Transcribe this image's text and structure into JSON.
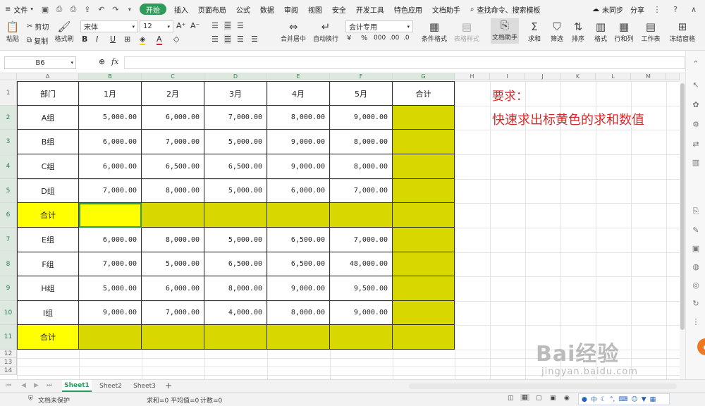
{
  "menubar": {
    "file_label": "文件",
    "tabs": [
      "开始",
      "插入",
      "页面布局",
      "公式",
      "数据",
      "审阅",
      "视图",
      "安全",
      "开发工具",
      "特色应用",
      "文档助手"
    ],
    "search_label": "查找命令、搜索模板",
    "sync_label": "未同步",
    "share_label": "分享"
  },
  "ribbon": {
    "paste": "粘贴",
    "cut": "剪切",
    "copy": "复制",
    "format_painter": "格式刷",
    "font_name": "宋体",
    "font_size": "12",
    "merge_center": "合并居中",
    "wrap_text": "自动换行",
    "number_format": "会计专用",
    "cond_format": "条件格式",
    "table_style": "表格样式",
    "doc_helper": "文档助手",
    "sum": "求和",
    "filter": "筛选",
    "sort": "排序",
    "format": "格式",
    "row_col": "行和列",
    "worksheet": "工作表",
    "freeze": "冻结窗格"
  },
  "formula_bar": {
    "name_box": "B6",
    "fx_label": "fx",
    "content": ""
  },
  "columns": [
    "A",
    "B",
    "C",
    "D",
    "E",
    "F",
    "G",
    "H",
    "I",
    "J",
    "K",
    "L",
    "M"
  ],
  "rows": [
    "1",
    "2",
    "3",
    "4",
    "5",
    "6",
    "7",
    "8",
    "9",
    "10",
    "11",
    "12",
    "13",
    "14"
  ],
  "table": {
    "headers": [
      "部门",
      "1月",
      "2月",
      "3月",
      "4月",
      "5月",
      "合计"
    ],
    "data": [
      [
        "A组",
        "5,000.00",
        "6,000.00",
        "7,000.00",
        "8,000.00",
        "9,000.00",
        ""
      ],
      [
        "B组",
        "6,000.00",
        "7,000.00",
        "5,000.00",
        "9,000.00",
        "8,000.00",
        ""
      ],
      [
        "C组",
        "6,000.00",
        "6,500.00",
        "6,500.00",
        "9,000.00",
        "8,000.00",
        ""
      ],
      [
        "D组",
        "7,000.00",
        "8,000.00",
        "5,000.00",
        "6,000.00",
        "7,000.00",
        ""
      ],
      [
        "合计",
        "",
        "",
        "",
        "",
        "",
        ""
      ],
      [
        "E组",
        "6,000.00",
        "8,000.00",
        "5,000.00",
        "6,500.00",
        "7,000.00",
        ""
      ],
      [
        "F组",
        "7,000.00",
        "5,000.00",
        "6,500.00",
        "6,500.00",
        "48,000.00",
        ""
      ],
      [
        "H组",
        "5,000.00",
        "6,000.00",
        "8,000.00",
        "9,000.00",
        "9,500.00",
        ""
      ],
      [
        "I组",
        "9,000.00",
        "7,000.00",
        "4,000.00",
        "8,000.00",
        "9,000.00",
        ""
      ],
      [
        "合计",
        "",
        "",
        "",
        "",
        "",
        ""
      ]
    ]
  },
  "note": {
    "title": "要求：",
    "body": "快速求出标黄色的求和数值"
  },
  "sheets": [
    "Sheet1",
    "Sheet2",
    "Sheet3"
  ],
  "status": {
    "protect": "文档未保护",
    "sum": "求和=0",
    "avg": "平均值=0",
    "count": "计数=0",
    "ime": "中"
  },
  "watermark": {
    "brand": "Bai经验",
    "url": "jingyan.baidu.com"
  },
  "colors": {
    "yellow_selected": "#ffff00",
    "yellow_fill": "#d8d800",
    "accent": "#2f9b5b",
    "note_red": "#d22a2a"
  }
}
